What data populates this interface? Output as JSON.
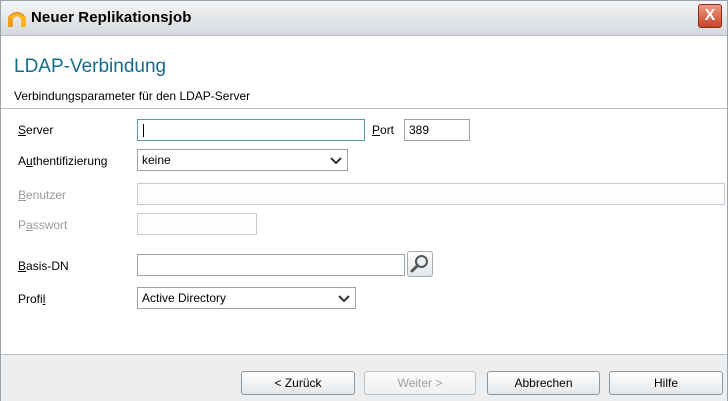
{
  "window": {
    "title": "Neuer Replikationsjob",
    "close_label": "X"
  },
  "header": {
    "title": "LDAP-Verbindung",
    "subtitle": "Verbindungsparameter für den LDAP-Server"
  },
  "form": {
    "server": {
      "label_access": "S",
      "label_rest": "erver",
      "value": ""
    },
    "port": {
      "label_access": "P",
      "label_rest": "ort",
      "value": "389"
    },
    "auth": {
      "label_pre": "A",
      "label_access": "u",
      "label_rest": "thentifizierung",
      "value": "keine"
    },
    "user": {
      "label_access": "B",
      "label_rest": "enutzer",
      "value": ""
    },
    "password": {
      "label_pre": "P",
      "label_access": "a",
      "label_rest": "sswort",
      "value": ""
    },
    "basedn": {
      "label_access": "B",
      "label_rest": "asis-DN",
      "value": ""
    },
    "profile": {
      "label_pre": "Profi",
      "label_access": "l",
      "value": "Active Directory"
    }
  },
  "buttons": {
    "back": "< Zurück",
    "next": "Weiter >",
    "cancel": "Abbrechen",
    "help": "Hilfe"
  },
  "colors": {
    "header_title": "#156c8a",
    "close_button": "#c6432a"
  },
  "icons": {
    "app": "app-logo-icon",
    "close": "close-icon",
    "dropdown": "chevron-down-icon",
    "search": "magnifier-icon"
  }
}
